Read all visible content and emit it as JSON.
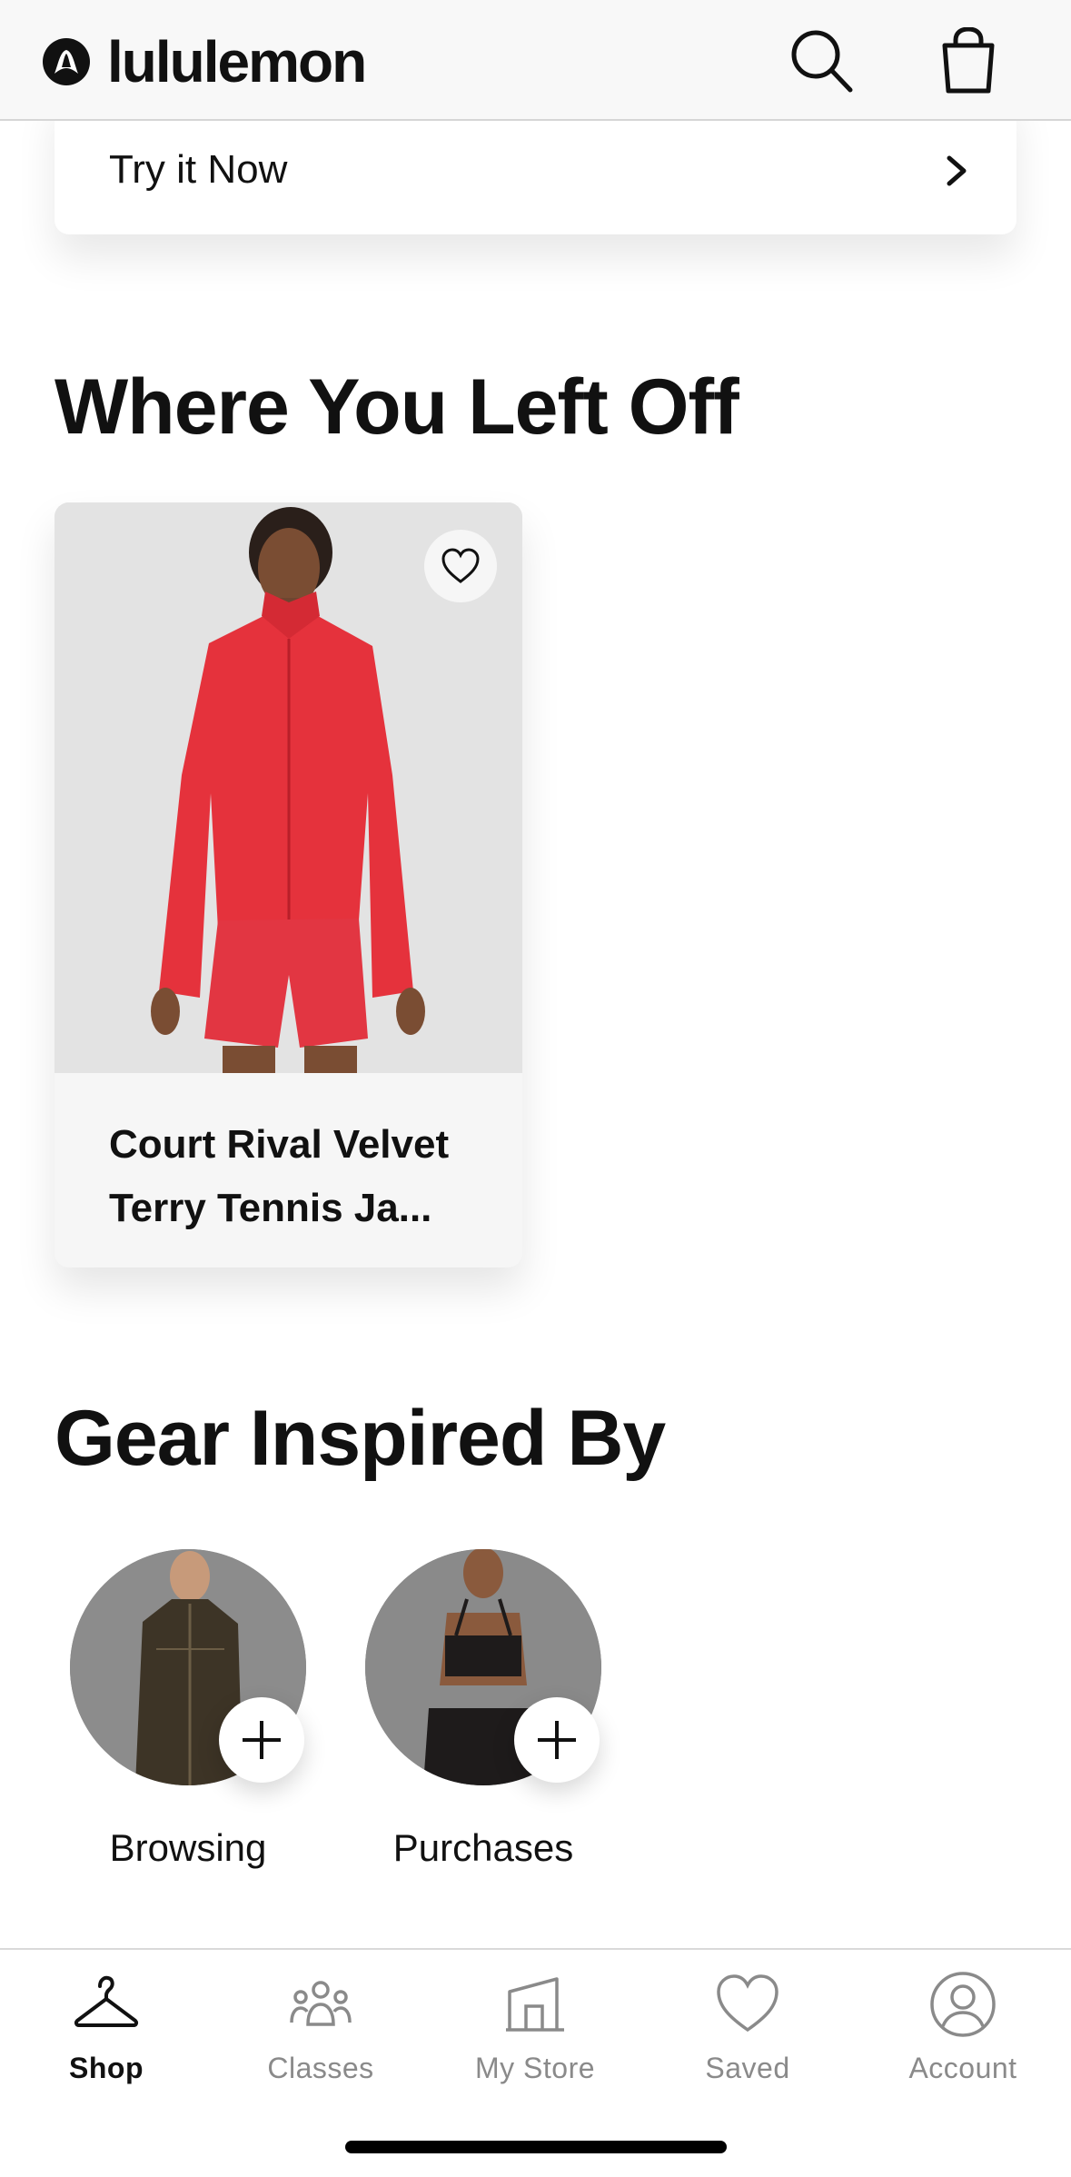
{
  "header": {
    "brand_name": "lululemon",
    "logo_icon": "lululemon-logo-icon",
    "search_icon": "search-icon",
    "bag_icon": "shopping-bag-icon"
  },
  "promo": {
    "label": "Try it Now",
    "chevron_icon": "chevron-right-icon"
  },
  "where_you_left_off": {
    "title": "Where You Left Off",
    "product": {
      "name": "Court Rival Velvet Terry Tennis Ja...",
      "image_desc_icon": "product-photo",
      "favorite_icon": "heart-icon",
      "garment_color": "#e5323c"
    }
  },
  "gear_inspired_by": {
    "title": "Gear Inspired By",
    "items": [
      {
        "label": "Browsing",
        "add_icon": "plus-icon"
      },
      {
        "label": "Purchases",
        "add_icon": "plus-icon"
      }
    ]
  },
  "tabbar": {
    "items": [
      {
        "label": "Shop",
        "icon": "hanger-icon",
        "active": true
      },
      {
        "label": "Classes",
        "icon": "people-icon",
        "active": false
      },
      {
        "label": "My Store",
        "icon": "store-icon",
        "active": false
      },
      {
        "label": "Saved",
        "icon": "heart-icon",
        "active": false
      },
      {
        "label": "Account",
        "icon": "user-circle-icon",
        "active": false
      }
    ]
  },
  "colors": {
    "text": "#111111",
    "inactive_tab": "#8a8a8a",
    "header_bg": "#f8f8f8"
  }
}
